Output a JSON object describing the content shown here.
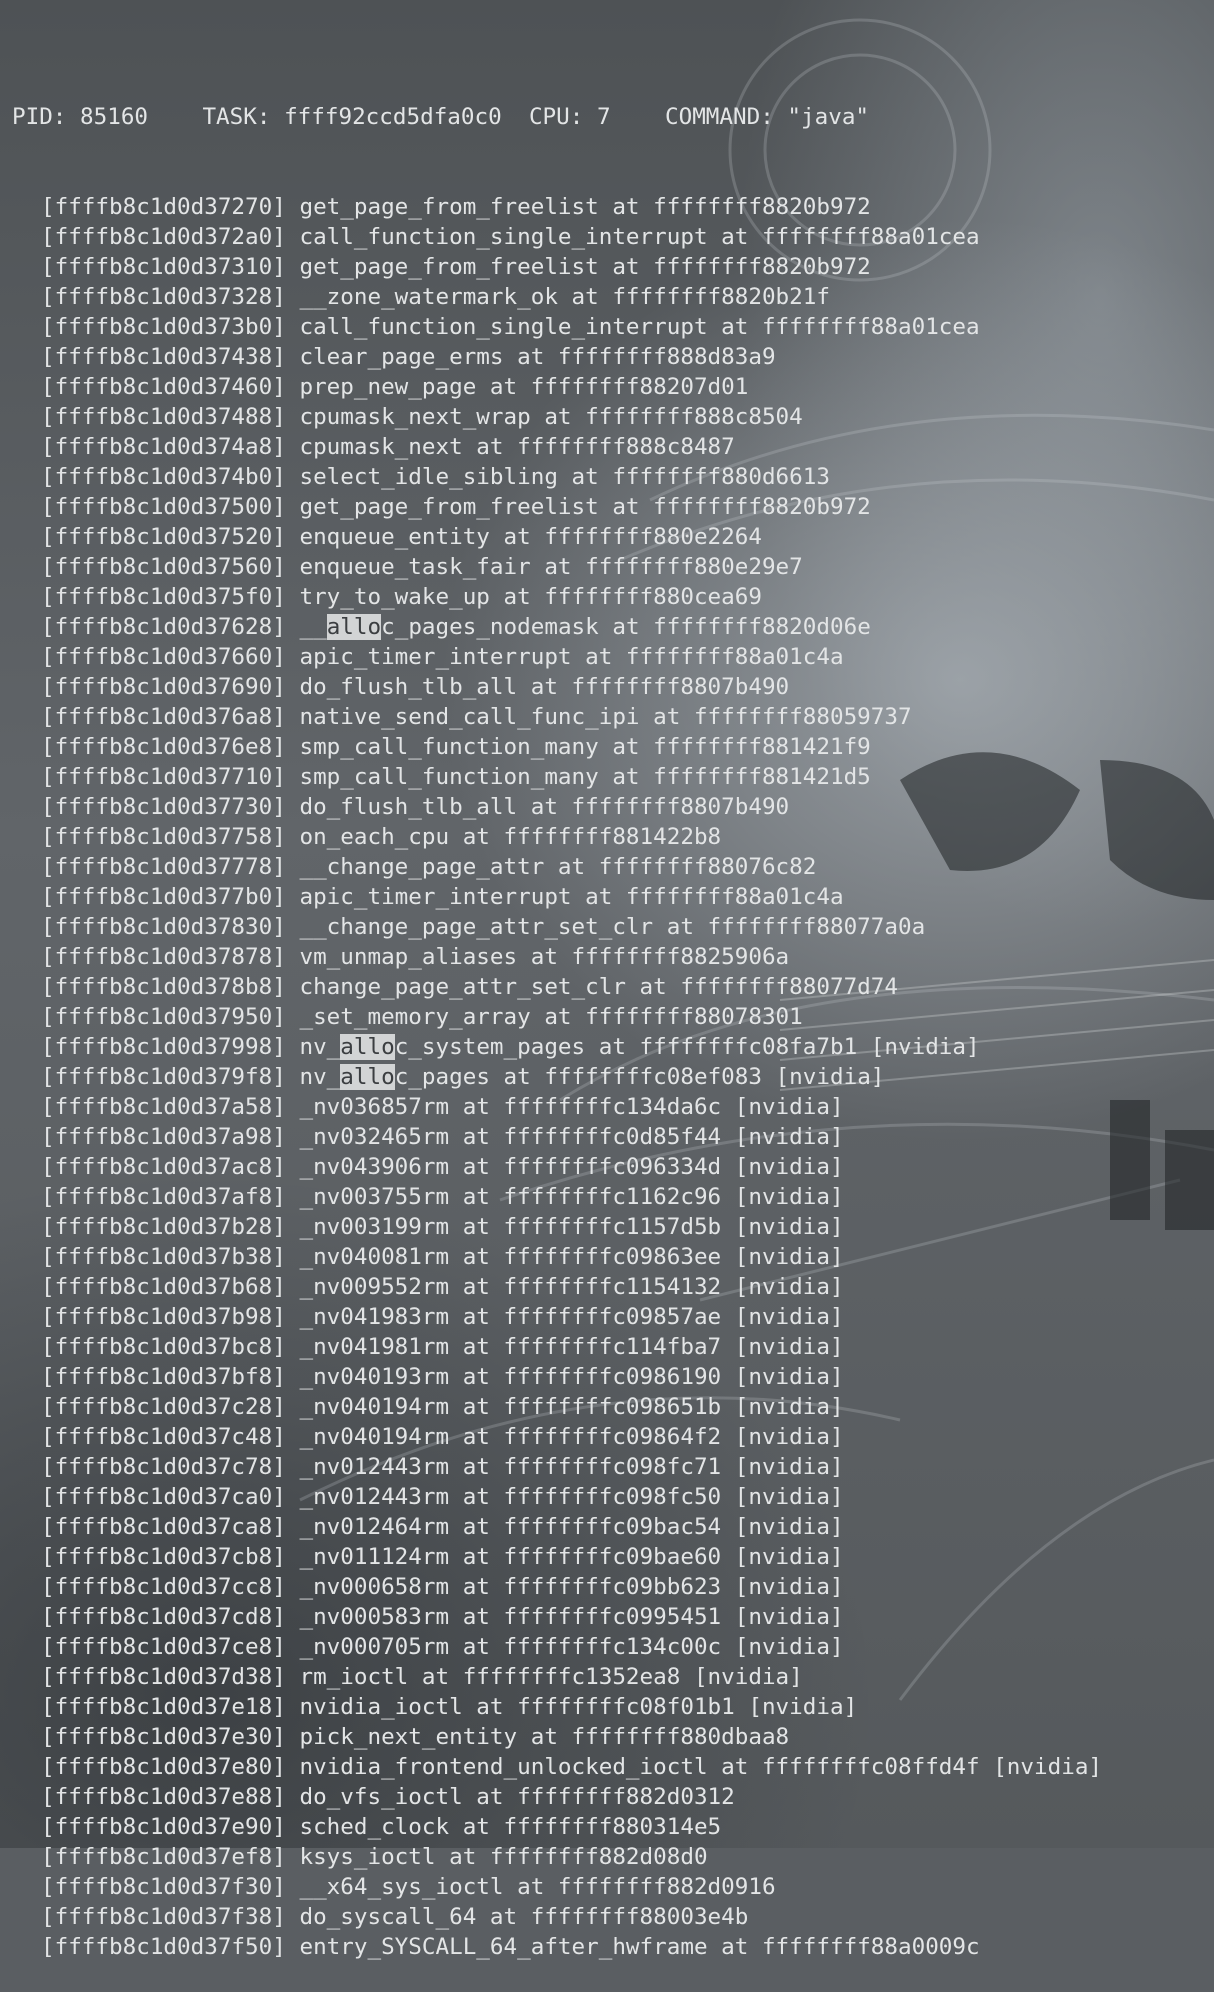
{
  "header": {
    "pid_label": "PID: 85160",
    "task_label": "TASK: ffff92ccd5dfa0c0",
    "cpu_label": "CPU: 7",
    "command_label": "COMMAND: \"java\""
  },
  "search_highlight": "allo",
  "frames": [
    {
      "addr": "[ffffb8c1d0d37270]",
      "text": "get_page_from_freelist at ffffffff8820b972"
    },
    {
      "addr": "[ffffb8c1d0d372a0]",
      "text": "call_function_single_interrupt at ffffffff88a01cea"
    },
    {
      "addr": "[ffffb8c1d0d37310]",
      "text": "get_page_from_freelist at ffffffff8820b972"
    },
    {
      "addr": "[ffffb8c1d0d37328]",
      "text": "__zone_watermark_ok at ffffffff8820b21f"
    },
    {
      "addr": "[ffffb8c1d0d373b0]",
      "text": "call_function_single_interrupt at ffffffff88a01cea"
    },
    {
      "addr": "[ffffb8c1d0d37438]",
      "text": "clear_page_erms at ffffffff888d83a9"
    },
    {
      "addr": "[ffffb8c1d0d37460]",
      "text": "prep_new_page at ffffffff88207d01"
    },
    {
      "addr": "[ffffb8c1d0d37488]",
      "text": "cpumask_next_wrap at ffffffff888c8504"
    },
    {
      "addr": "[ffffb8c1d0d374a8]",
      "text": "cpumask_next at ffffffff888c8487"
    },
    {
      "addr": "[ffffb8c1d0d374b0]",
      "text": "select_idle_sibling at ffffffff880d6613"
    },
    {
      "addr": "[ffffb8c1d0d37500]",
      "text": "get_page_from_freelist at ffffffff8820b972"
    },
    {
      "addr": "[ffffb8c1d0d37520]",
      "text": "enqueue_entity at ffffffff880e2264"
    },
    {
      "addr": "[ffffb8c1d0d37560]",
      "text": "enqueue_task_fair at ffffffff880e29e7"
    },
    {
      "addr": "[ffffb8c1d0d375f0]",
      "text": "try_to_wake_up at ffffffff880cea69"
    },
    {
      "addr": "[ffffb8c1d0d37628]",
      "text": "__alloc_pages_nodemask at ffffffff8820d06e",
      "hl": {
        "before": "__",
        "match": "allo",
        "after": "c_pages_nodemask at ffffffff8820d06e"
      }
    },
    {
      "addr": "[ffffb8c1d0d37660]",
      "text": "apic_timer_interrupt at ffffffff88a01c4a"
    },
    {
      "addr": "[ffffb8c1d0d37690]",
      "text": "do_flush_tlb_all at ffffffff8807b490"
    },
    {
      "addr": "[ffffb8c1d0d376a8]",
      "text": "native_send_call_func_ipi at ffffffff88059737"
    },
    {
      "addr": "[ffffb8c1d0d376e8]",
      "text": "smp_call_function_many at ffffffff881421f9"
    },
    {
      "addr": "[ffffb8c1d0d37710]",
      "text": "smp_call_function_many at ffffffff881421d5"
    },
    {
      "addr": "[ffffb8c1d0d37730]",
      "text": "do_flush_tlb_all at ffffffff8807b490"
    },
    {
      "addr": "[ffffb8c1d0d37758]",
      "text": "on_each_cpu at ffffffff881422b8"
    },
    {
      "addr": "[ffffb8c1d0d37778]",
      "text": "__change_page_attr at ffffffff88076c82"
    },
    {
      "addr": "[ffffb8c1d0d377b0]",
      "text": "apic_timer_interrupt at ffffffff88a01c4a"
    },
    {
      "addr": "[ffffb8c1d0d37830]",
      "text": "__change_page_attr_set_clr at ffffffff88077a0a"
    },
    {
      "addr": "[ffffb8c1d0d37878]",
      "text": "vm_unmap_aliases at ffffffff8825906a"
    },
    {
      "addr": "[ffffb8c1d0d378b8]",
      "text": "change_page_attr_set_clr at ffffffff88077d74"
    },
    {
      "addr": "[ffffb8c1d0d37950]",
      "text": "_set_memory_array at ffffffff88078301"
    },
    {
      "addr": "[ffffb8c1d0d37998]",
      "text": "nv_alloc_system_pages at ffffffffc08fa7b1 [nvidia]",
      "hl": {
        "before": "nv_",
        "match": "allo",
        "after": "c_system_pages at ffffffffc08fa7b1 [nvidia]"
      }
    },
    {
      "addr": "[ffffb8c1d0d379f8]",
      "text": "nv_alloc_pages at ffffffffc08ef083 [nvidia]",
      "hl": {
        "before": "nv_",
        "match": "allo",
        "after": "c_pages at ffffffffc08ef083 [nvidia]"
      }
    },
    {
      "addr": "[ffffb8c1d0d37a58]",
      "text": "_nv036857rm at ffffffffc134da6c [nvidia]"
    },
    {
      "addr": "[ffffb8c1d0d37a98]",
      "text": "_nv032465rm at ffffffffc0d85f44 [nvidia]"
    },
    {
      "addr": "[ffffb8c1d0d37ac8]",
      "text": "_nv043906rm at ffffffffc096334d [nvidia]"
    },
    {
      "addr": "[ffffb8c1d0d37af8]",
      "text": "_nv003755rm at ffffffffc1162c96 [nvidia]"
    },
    {
      "addr": "[ffffb8c1d0d37b28]",
      "text": "_nv003199rm at ffffffffc1157d5b [nvidia]"
    },
    {
      "addr": "[ffffb8c1d0d37b38]",
      "text": "_nv040081rm at ffffffffc09863ee [nvidia]"
    },
    {
      "addr": "[ffffb8c1d0d37b68]",
      "text": "_nv009552rm at ffffffffc1154132 [nvidia]"
    },
    {
      "addr": "[ffffb8c1d0d37b98]",
      "text": "_nv041983rm at ffffffffc09857ae [nvidia]"
    },
    {
      "addr": "[ffffb8c1d0d37bc8]",
      "text": "_nv041981rm at ffffffffc114fba7 [nvidia]"
    },
    {
      "addr": "[ffffb8c1d0d37bf8]",
      "text": "_nv040193rm at ffffffffc0986190 [nvidia]"
    },
    {
      "addr": "[ffffb8c1d0d37c28]",
      "text": "_nv040194rm at ffffffffc098651b [nvidia]"
    },
    {
      "addr": "[ffffb8c1d0d37c48]",
      "text": "_nv040194rm at ffffffffc09864f2 [nvidia]"
    },
    {
      "addr": "[ffffb8c1d0d37c78]",
      "text": "_nv012443rm at ffffffffc098fc71 [nvidia]"
    },
    {
      "addr": "[ffffb8c1d0d37ca0]",
      "text": "_nv012443rm at ffffffffc098fc50 [nvidia]"
    },
    {
      "addr": "[ffffb8c1d0d37ca8]",
      "text": "_nv012464rm at ffffffffc09bac54 [nvidia]"
    },
    {
      "addr": "[ffffb8c1d0d37cb8]",
      "text": "_nv011124rm at ffffffffc09bae60 [nvidia]"
    },
    {
      "addr": "[ffffb8c1d0d37cc8]",
      "text": "_nv000658rm at ffffffffc09bb623 [nvidia]"
    },
    {
      "addr": "[ffffb8c1d0d37cd8]",
      "text": "_nv000583rm at ffffffffc0995451 [nvidia]"
    },
    {
      "addr": "[ffffb8c1d0d37ce8]",
      "text": "_nv000705rm at ffffffffc134c00c [nvidia]"
    },
    {
      "addr": "[ffffb8c1d0d37d38]",
      "text": "rm_ioctl at ffffffffc1352ea8 [nvidia]"
    },
    {
      "addr": "[ffffb8c1d0d37e18]",
      "text": "nvidia_ioctl at ffffffffc08f01b1 [nvidia]"
    },
    {
      "addr": "[ffffb8c1d0d37e30]",
      "text": "pick_next_entity at ffffffff880dbaa8"
    },
    {
      "addr": "[ffffb8c1d0d37e80]",
      "text": "nvidia_frontend_unlocked_ioctl at ffffffffc08ffd4f [nvidia]"
    },
    {
      "addr": "[ffffb8c1d0d37e88]",
      "text": "do_vfs_ioctl at ffffffff882d0312"
    },
    {
      "addr": "[ffffb8c1d0d37e90]",
      "text": "sched_clock at ffffffff880314e5"
    },
    {
      "addr": "[ffffb8c1d0d37ef8]",
      "text": "ksys_ioctl at ffffffff882d08d0"
    },
    {
      "addr": "[ffffb8c1d0d37f30]",
      "text": "__x64_sys_ioctl at ffffffff882d0916"
    },
    {
      "addr": "[ffffb8c1d0d37f38]",
      "text": "do_syscall_64 at ffffffff88003e4b"
    },
    {
      "addr": "[ffffb8c1d0d37f50]",
      "text": "entry_SYSCALL_64_after_hwframe at ffffffff88a0009c"
    }
  ],
  "colors": {
    "text": "#e3e5e6",
    "highlight_bg": "#d2d4d5",
    "highlight_fg": "#3b3e41",
    "background": "#5a5e62"
  }
}
